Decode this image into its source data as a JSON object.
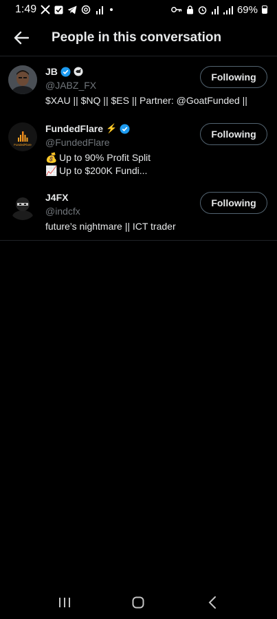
{
  "status_bar": {
    "time": "1:49",
    "battery": "69%",
    "left_icons": [
      "x-app-icon",
      "checkbox-app-icon",
      "telegram-icon",
      "at-sign-icon",
      "data-signal-icon"
    ],
    "right_icons": [
      "key-icon",
      "lock-icon",
      "alarm-icon",
      "wifi-icon",
      "signal-bars-icon",
      "battery-icon"
    ]
  },
  "header": {
    "title": "People in this conversation",
    "back_icon": "back-arrow-icon"
  },
  "people": [
    {
      "name": "JB",
      "handle": "@JABZ_FX",
      "bio": "$XAU || $NQ || $ES || Partner: @GoatFunded ||",
      "verified": true,
      "badge_icon": "rhino-badge-icon",
      "button_label": "Following"
    },
    {
      "name": "FundedFlare",
      "handle": "@FundedFlare",
      "bio_lines": [
        "Up to 90% Profit Split",
        "Up to $200K Fundi..."
      ],
      "bio_emojis": [
        "💰",
        "📈"
      ],
      "name_emoji": "⚡",
      "avatar_text": "FundedFlare",
      "verified": true,
      "button_label": "Following"
    },
    {
      "name": "J4FX",
      "handle": "@indcfx",
      "bio": "future’s nightmare || ICT trader",
      "verified": false,
      "button_label": "Following"
    }
  ],
  "colors": {
    "background": "#000000",
    "text": "#e7e9ea",
    "secondary_text": "#71767b",
    "verified_blue": "#1d9bf0",
    "border": "#536471"
  },
  "nav": {
    "recents_icon": "recents-icon",
    "home_icon": "home-icon",
    "back_icon": "nav-back-icon"
  }
}
